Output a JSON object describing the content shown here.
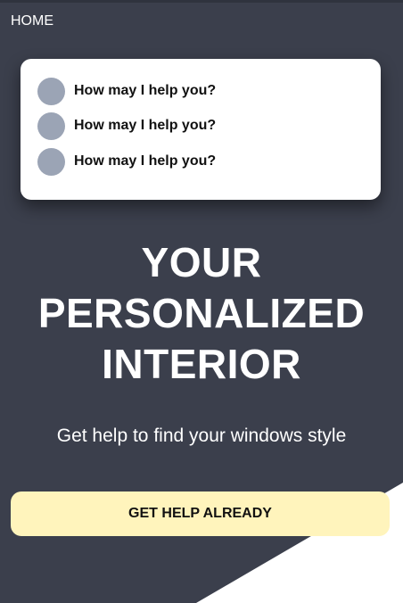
{
  "nav": {
    "home_label": "HOME"
  },
  "help_card": {
    "items": [
      {
        "avatar": "avatar-circle",
        "label": "How may I help you?"
      },
      {
        "avatar": "avatar-circle",
        "label": "How may I help you?"
      },
      {
        "avatar": "avatar-circle",
        "label": "How may I help you?"
      }
    ]
  },
  "hero": {
    "title_lines": [
      "YOUR",
      "PERSONALIZED",
      "INTERIOR"
    ],
    "subtitle": "Get help to find your windows style"
  },
  "cta": {
    "label": "GET HELP ALREADY"
  },
  "colors": {
    "background": "#3b3f4c",
    "accent_triangle": "#ffffff",
    "card": "#ffffff",
    "avatar": "#9ba4b5",
    "cta_background": "#fff4bc"
  }
}
